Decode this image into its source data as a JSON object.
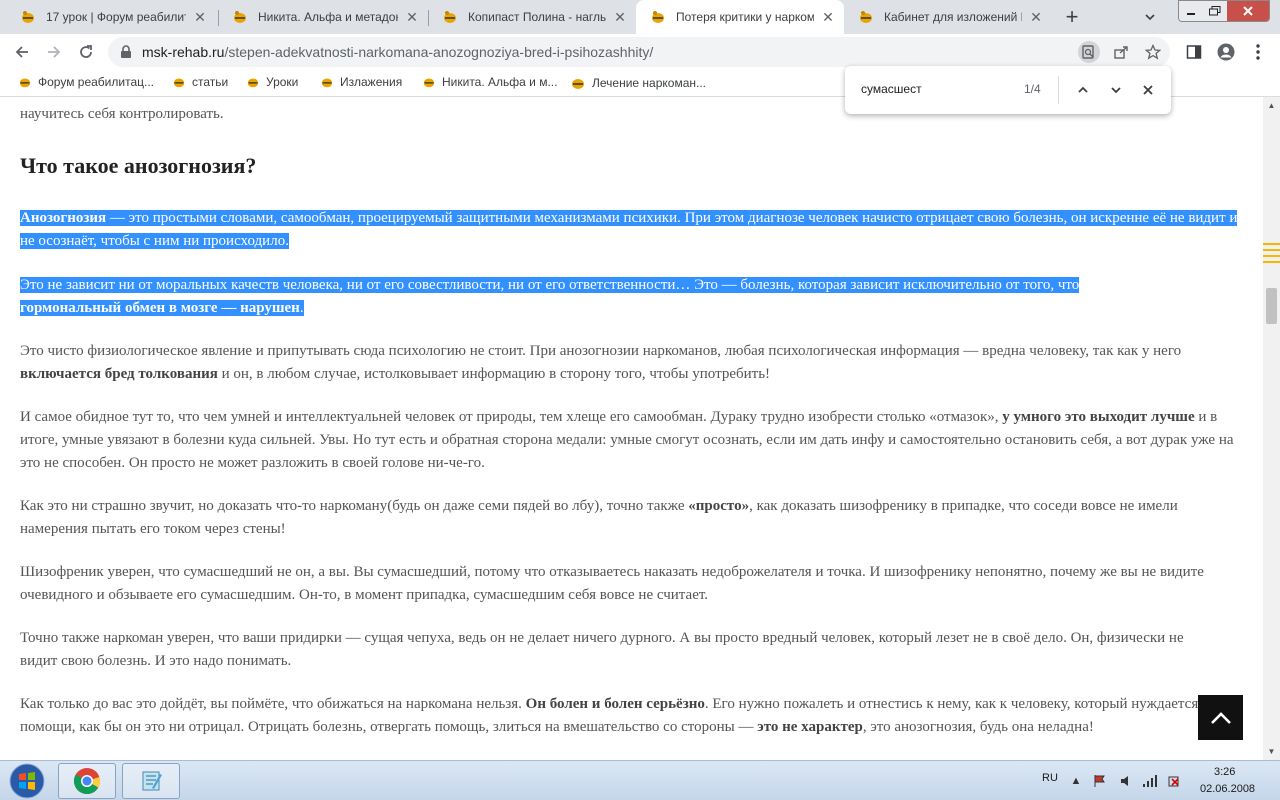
{
  "tabs": [
    {
      "title": "17 урок | Форум реабилит",
      "active": false
    },
    {
      "title": "Никита. Альфа и метадон.",
      "active": false
    },
    {
      "title": "Копипаст Полина - наглы",
      "active": false
    },
    {
      "title": "Потеря критики у нарком",
      "active": true
    },
    {
      "title": "Кабинет для изложений Н",
      "active": false
    }
  ],
  "new_tab_label": "+",
  "address": {
    "domain": "msk-rehab.ru",
    "path": "/stepen-adekvatnosti-narkomana-anozognoziya-bred-i-psihozashhity/"
  },
  "bookmarks": [
    {
      "label": "Форум реабилитац..."
    },
    {
      "label": "статьи"
    },
    {
      "label": "Уроки"
    },
    {
      "label": "Излажения"
    },
    {
      "label": "Никита. Альфа и м..."
    },
    {
      "label": "Лечение наркоман..."
    }
  ],
  "find": {
    "query": "сумасшест",
    "count": "1/4"
  },
  "article": {
    "p0": "научитесь себя контролировать.",
    "heading": "Что такое анозогнозия?",
    "p1": {
      "b1": "Анозогнозия",
      "t1": " — это простыми словами, самообман, проецируемый защитными механизмами психики. При этом диагнозе человек начисто отрицает свою болезнь, он искренне её не видит и не осознаёт, чтобы с ним ни происходило."
    },
    "p2": {
      "t1": "Это не зависит ни от моральных качеств человека, ни от его совестливости, ни от его ответственности… Это — болезнь, которая зависит исключительно от того, что ",
      "b1": "гормональный обмен в мозге — нарушен",
      "t2": "."
    },
    "p3": {
      "t1": "Это чисто физиологическое явление и припутывать сюда психологию не стоит. При анозогнозии наркоманов, любая психологическая информация — вредна человеку, так как у него ",
      "b1": "включается бред толкования",
      "t2": " и он, в любом случае, истолковывает информацию в сторону того, чтобы употребить!"
    },
    "p4": {
      "t1": "И самое обидное тут то, что чем умней и интеллектуальней человек от природы, тем хлеще его самообман. Дураку трудно изобрести столько «отмазок», ",
      "b1": "у умного это выходит лучше",
      "t2": " и в итоге, умные увязают в болезни куда сильней. Увы. Но тут есть и обратная сторона медали: умные смогут осознать, если им дать инфу и самостоятельно остановить себя, а вот дурак уже на это не способен. Он просто не может разложить в своей голове ни-че-го."
    },
    "p5": {
      "t1": "Как это ни страшно звучит, но доказать что-то наркоману(будь он даже семи пядей во лбу), точно также ",
      "b1": "«просто»",
      "t2": ", как доказать шизофренику в припадке, что соседи вовсе не имели намерения пытать его током через стены!"
    },
    "p6": "Шизофреник уверен, что сумасшедший не он, а вы. Вы сумасшедший, потому что отказываетесь наказать недоброжелателя и точка. И шизофренику непонятно, почему же вы не видите очевидного и обзываете его сумасшедшим. Он-то, в момент припадка, сумасшедшим себя вовсе не считает.",
    "p7": "Точно также наркоман уверен, что ваши придирки — сущая чепуха, ведь он не делает ничего дурного. А вы просто вредный человек, который лезет не в своё дело. Он, физически не видит свою болезнь. И это надо понимать.",
    "p8": {
      "t1": "Как только до вас это дойдёт, вы поймёте, что обижаться на наркомана нельзя. ",
      "b1": "Он болен и болен серьёзно",
      "t2": ". Его нужно пожалеть и отнестись к нему, как к человеку, который нуждается в помощи, как бы он это ни отрицал. Отрицать болезнь, отвергать помощь, злиться на вмешательство со стороны — ",
      "b2": "это не характер",
      "t3": ", это анозогнозия, будь она неладна!"
    }
  },
  "taskbar": {
    "lang": "RU",
    "time": "3:26",
    "date": "02.06.2008"
  },
  "colors": {
    "selection": "#3390ff",
    "scroll_marker": "#f5b800",
    "tabstrip": "#dee1e6"
  }
}
